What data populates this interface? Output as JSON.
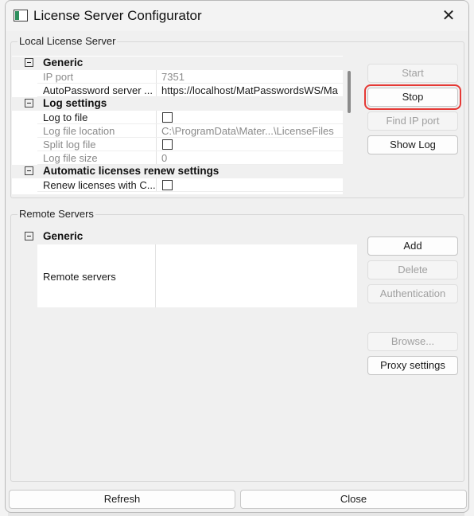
{
  "window": {
    "title": "License Server Configurator"
  },
  "local": {
    "group_label": "Local License Server",
    "rows": [
      {
        "kind": "category",
        "label": "Generic"
      },
      {
        "kind": "prop",
        "name": "IP port",
        "value": "7351",
        "dim": true
      },
      {
        "kind": "prop",
        "name": "AutoPassword server ...",
        "value": "https://localhost/MatPasswordsWS/Ma",
        "dim": false
      },
      {
        "kind": "category",
        "label": "Log settings"
      },
      {
        "kind": "prop",
        "name": "Log to file",
        "checkbox": true,
        "checked": false,
        "dim": false
      },
      {
        "kind": "prop",
        "name": "Log file location",
        "value": "C:\\ProgramData\\Mater...\\LicenseFiles",
        "dim": true
      },
      {
        "kind": "prop",
        "name": "Split log file",
        "checkbox": true,
        "checked": false,
        "dim": true
      },
      {
        "kind": "prop",
        "name": "Log file size",
        "value": "0",
        "dim": true
      },
      {
        "kind": "category",
        "label": "Automatic licenses renew settings"
      },
      {
        "kind": "prop",
        "name": "Renew licenses with C...",
        "checkbox": true,
        "checked": false,
        "dim": false
      }
    ],
    "buttons": {
      "start": "Start",
      "stop": "Stop",
      "find_ip": "Find IP port",
      "show_log": "Show Log"
    }
  },
  "remote": {
    "group_label": "Remote Servers",
    "category": "Generic",
    "prop_name": "Remote servers",
    "buttons": {
      "add": "Add",
      "delete": "Delete",
      "auth": "Authentication",
      "browse": "Browse...",
      "proxy": "Proxy settings"
    }
  },
  "footer": {
    "refresh": "Refresh",
    "close": "Close"
  },
  "colors": {
    "highlight": "#e53935"
  }
}
